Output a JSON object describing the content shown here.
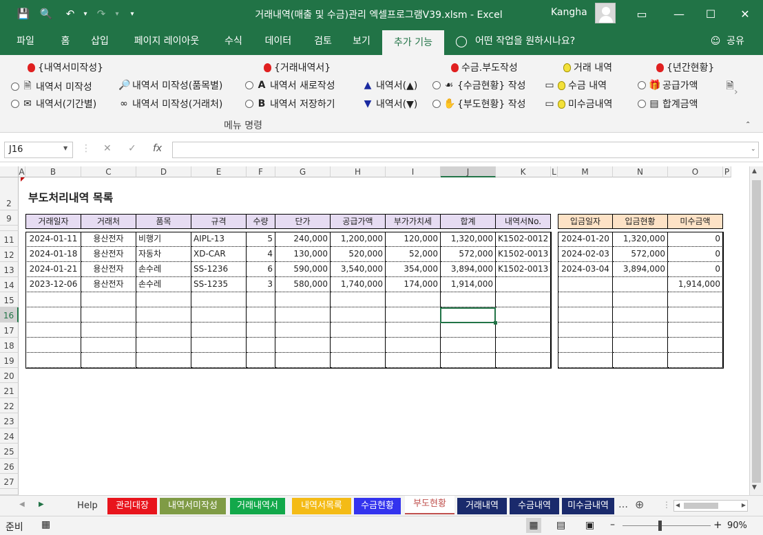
{
  "window": {
    "title": "거래내역(매출 및 수금)관리 엑셀프로그램V39.xlsm  -  Excel",
    "user": "Kangha"
  },
  "menu": {
    "tabs": [
      "파일",
      "홈",
      "삽입",
      "페이지 레이아웃",
      "수식",
      "데이터",
      "검토",
      "보기",
      "추가 기능"
    ],
    "tell_me": "어떤 작업을 원하시나요?",
    "share": "공유"
  },
  "ribbon": {
    "r1": [
      "{내역서미작성}",
      "{거래내역서}",
      "수금.부도작성",
      "거래 내역",
      "{년간현황}"
    ],
    "r2": [
      "내역서 미작성",
      "내역서 미작성(품목별)",
      "내역서 새로작성",
      "내역서(▲)",
      "{수금현황} 작성",
      "수금 내역",
      "공급가액"
    ],
    "r3": [
      "내역서(기간별)",
      "내역서 미작성(거래처)",
      "내역서 저장하기",
      "내역서(▼)",
      "{부도현황} 작성",
      "미수금내역",
      "합계금액"
    ],
    "group_label": "메뉴 명령",
    "letter_a": "A",
    "letter_b": "B"
  },
  "formula": {
    "namebox": "J16",
    "fx": "fx"
  },
  "columns": [
    "A",
    "B",
    "C",
    "D",
    "E",
    "F",
    "G",
    "H",
    "I",
    "J",
    "K",
    "L",
    "M",
    "N",
    "O",
    "P"
  ],
  "rows": [
    "2",
    "9",
    "11",
    "12",
    "13",
    "14",
    "15",
    "16",
    "17",
    "18",
    "19",
    "20",
    "21",
    "22",
    "23",
    "24",
    "25",
    "26",
    "27"
  ],
  "sheet": {
    "title": "부도처리내역 목록",
    "headers_left": [
      "거래일자",
      "거래처",
      "품목",
      "규격",
      "수량",
      "단가",
      "공급가액",
      "부가가치세",
      "합계",
      "내역서No."
    ],
    "headers_right": [
      "입금일자",
      "입금현황",
      "미수금액"
    ],
    "data_left": [
      [
        "2024-01-11",
        "용산전자",
        "비행기",
        "AIPL-13",
        "5",
        "240,000",
        "1,200,000",
        "120,000",
        "1,320,000",
        "K1502-0012"
      ],
      [
        "2024-01-18",
        "용산전자",
        "자동차",
        "XD-CAR",
        "4",
        "130,000",
        "520,000",
        "52,000",
        "572,000",
        "K1502-0013"
      ],
      [
        "2024-01-21",
        "용산전자",
        "손수레",
        "SS-1236",
        "6",
        "590,000",
        "3,540,000",
        "354,000",
        "3,894,000",
        "K1502-0013"
      ],
      [
        "2023-12-06",
        "용산전자",
        "손수레",
        "SS-1235",
        "3",
        "580,000",
        "1,740,000",
        "174,000",
        "1,914,000",
        ""
      ]
    ],
    "data_right": [
      [
        "2024-01-20",
        "1,320,000",
        "0"
      ],
      [
        "2024-02-03",
        "572,000",
        "0"
      ],
      [
        "2024-03-04",
        "3,894,000",
        "0"
      ],
      [
        "",
        "",
        "1,914,000"
      ]
    ]
  },
  "sheet_tabs": [
    {
      "label": "Help",
      "bg": "#f3f3f3",
      "fg": "#333"
    },
    {
      "label": "관리대장",
      "bg": "#e8141c",
      "fg": "#ffffff"
    },
    {
      "label": "내역서미작성",
      "bg": "#7f9b45",
      "fg": "#ffffff"
    },
    {
      "label": "거래내역서",
      "bg": "#12a84a",
      "fg": "#ffffff"
    },
    {
      "label": "내역서목록",
      "bg": "#f4bb16",
      "fg": "#ffffff"
    },
    {
      "label": "수금현황",
      "bg": "#3333ee",
      "fg": "#ffffff"
    },
    {
      "label": "부도현황",
      "bg": "#ffffff",
      "fg": "#c0504d"
    },
    {
      "label": "거래내역",
      "bg": "#1a2a6c",
      "fg": "#ffffff"
    },
    {
      "label": "수금내역",
      "bg": "#1a2a6c",
      "fg": "#ffffff"
    },
    {
      "label": "미수금내역",
      "bg": "#1a2a6c",
      "fg": "#ffffff"
    }
  ],
  "status": {
    "ready": "준비",
    "zoom": "90%"
  }
}
